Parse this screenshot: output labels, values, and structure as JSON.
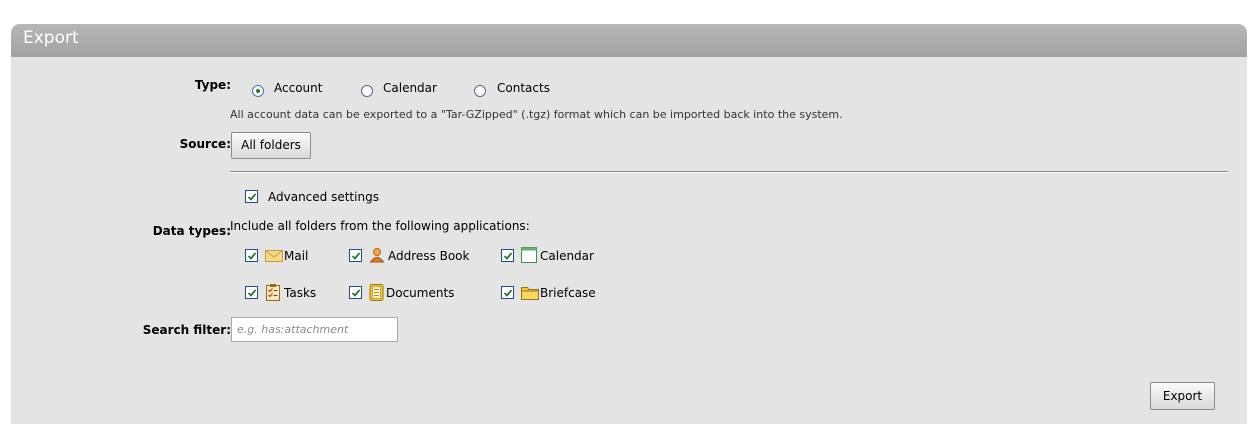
{
  "panel": {
    "title": "Export"
  },
  "type": {
    "label": "Type:",
    "options": [
      {
        "label": "Account",
        "selected": true
      },
      {
        "label": "Calendar",
        "selected": false
      },
      {
        "label": "Contacts",
        "selected": false
      }
    ],
    "description": "All account data can be exported to a \"Tar-GZipped\" (.tgz) format which can be imported back into the system."
  },
  "source": {
    "label": "Source:",
    "button_label": "All folders"
  },
  "advanced": {
    "label": "Advanced settings",
    "checked": true
  },
  "data_types": {
    "label": "Data types:",
    "intro": "Include all folders from the following applications:",
    "items": [
      {
        "label": "Mail",
        "icon": "mail-icon",
        "checked": true
      },
      {
        "label": "Address Book",
        "icon": "address-book-icon",
        "checked": true
      },
      {
        "label": "Calendar",
        "icon": "calendar-icon",
        "checked": true
      },
      {
        "label": "Tasks",
        "icon": "tasks-icon",
        "checked": true
      },
      {
        "label": "Documents",
        "icon": "documents-icon",
        "checked": true
      },
      {
        "label": "Briefcase",
        "icon": "briefcase-icon",
        "checked": true
      }
    ]
  },
  "search_filter": {
    "label": "Search filter:",
    "placeholder": "e.g. has:attachment",
    "value": ""
  },
  "export_button": {
    "label": "Export"
  },
  "colors": {
    "header": "#a8a8a8",
    "panel": "#e4e4e4",
    "check": "#1f7a2f"
  }
}
